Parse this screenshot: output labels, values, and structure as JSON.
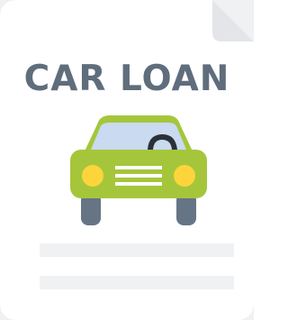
{
  "document": {
    "title": "CAR LOAN",
    "icon": "car-icon",
    "placeholder_lines": 2
  },
  "colors": {
    "background": "#f0f1f3",
    "paper": "#ffffff",
    "fold": "#e3e5e8",
    "title": "#5f6d7c",
    "car_body": "#a5c63b",
    "car_window": "#c9daf1",
    "headlights": "#fdd43c",
    "tires": "#667585",
    "grille": "#ffffff",
    "lines": "#f0f1f3"
  }
}
